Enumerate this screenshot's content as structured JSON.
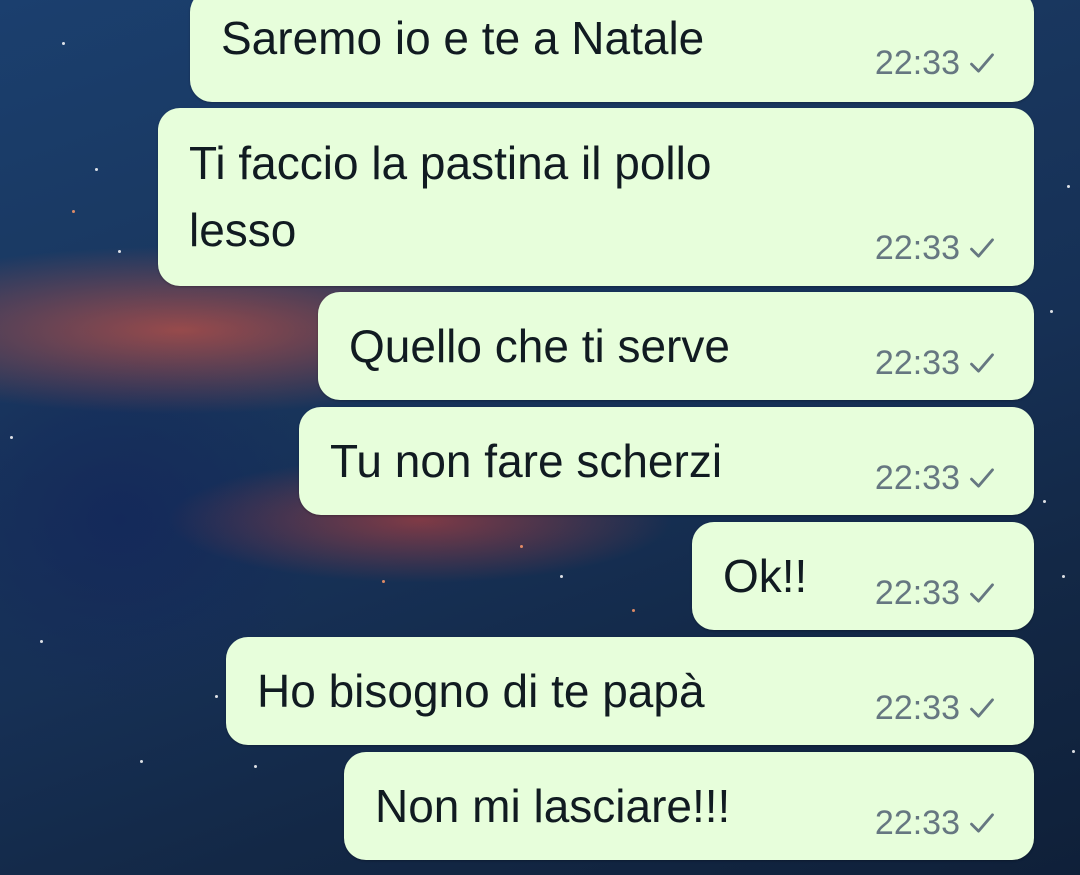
{
  "messages": [
    {
      "text": "Saremo io e te a Natale",
      "time": "22:33",
      "status_icon": "check-icon"
    },
    {
      "text": "Ti faccio la pastina il pollo",
      "text_line2": "lesso",
      "time": "22:33",
      "status_icon": "check-icon"
    },
    {
      "text": "Quello che ti serve",
      "time": "22:33",
      "status_icon": "check-icon"
    },
    {
      "text": "Tu non fare scherzi",
      "time": "22:33",
      "status_icon": "check-icon"
    },
    {
      "text": "Ok!!",
      "time": "22:33",
      "status_icon": "check-icon"
    },
    {
      "text": "Ho bisogno di te papà",
      "time": "22:33",
      "status_icon": "check-icon"
    },
    {
      "text": "Non mi lasciare!!!",
      "time": "22:33",
      "status_icon": "check-icon"
    }
  ],
  "colors": {
    "bubble_background": "#e7fedb",
    "message_text": "#111b21",
    "meta_text": "#667781"
  }
}
